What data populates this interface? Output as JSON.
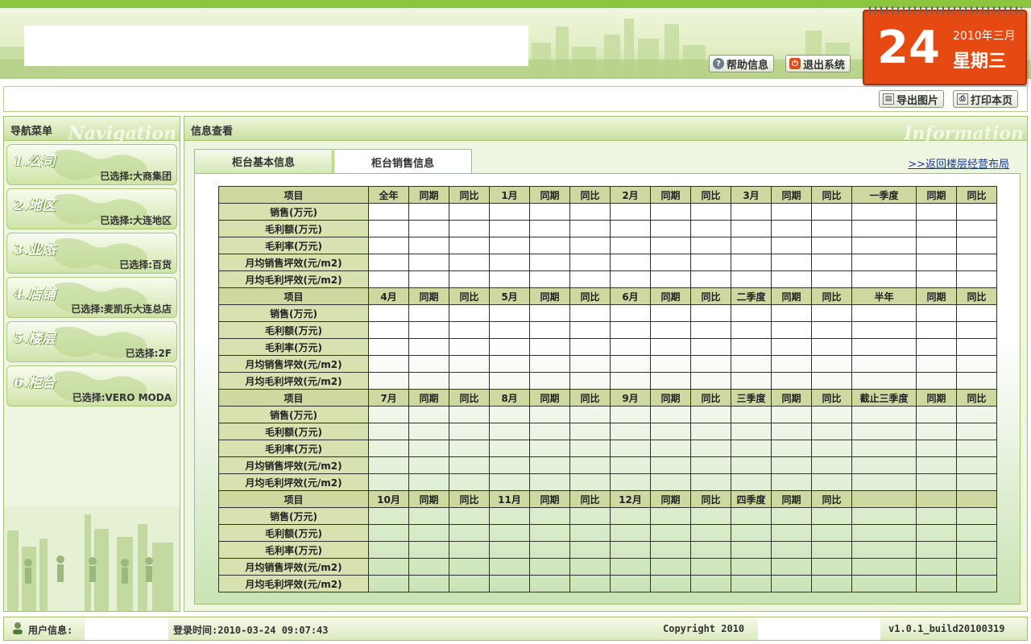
{
  "header": {
    "help_label": "帮助信息",
    "exit_label": "退出系统",
    "calendar": {
      "day": "24",
      "year_month": "2010年三月",
      "weekday": "星期三"
    }
  },
  "toolbar": {
    "export_label": "导出图片",
    "print_label": "打印本页"
  },
  "sidebar": {
    "title": "导航菜单",
    "watermark": "Navigation",
    "items": [
      {
        "num": "1.公司",
        "selected": "已选择:大商集团"
      },
      {
        "num": "2.地区",
        "selected": "已选择:大连地区"
      },
      {
        "num": "3.业态",
        "selected": "已选择:百货"
      },
      {
        "num": "4.店铺",
        "selected": "已选择:麦凯乐大连总店"
      },
      {
        "num": "5.楼层",
        "selected": "已选择:2F"
      },
      {
        "num": "6.柜台",
        "selected": "已选择:VERO MODA"
      }
    ]
  },
  "main": {
    "title": "信息查看",
    "watermark": "Information",
    "tabs": [
      {
        "label": "柜台基本信息"
      },
      {
        "label": "柜台销售信息"
      }
    ],
    "back_link": ">>返回楼层经营布局"
  },
  "table": {
    "row_labels": [
      "销售(万元)",
      "毛利额(万元)",
      "毛利率(万元)",
      "月均销售坪效(元/m2)",
      "月均毛利坪效(元/m2)"
    ],
    "blocks": [
      {
        "header": [
          "项目",
          "全年",
          "同期",
          "同比",
          "1月",
          "同期",
          "同比",
          "2月",
          "同期",
          "同比",
          "3月",
          "同期",
          "同比",
          "一季度",
          "同期",
          "同比"
        ]
      },
      {
        "header": [
          "项目",
          "4月",
          "同期",
          "同比",
          "5月",
          "同期",
          "同比",
          "6月",
          "同期",
          "同比",
          "二季度",
          "同期",
          "同比",
          "半年",
          "同期",
          "同比"
        ]
      },
      {
        "header": [
          "项目",
          "7月",
          "同期",
          "同比",
          "8月",
          "同期",
          "同比",
          "9月",
          "同期",
          "同比",
          "三季度",
          "同期",
          "同比",
          "截止三季度",
          "同期",
          "同比"
        ]
      },
      {
        "header": [
          "项目",
          "10月",
          "同期",
          "同比",
          "11月",
          "同期",
          "同比",
          "12月",
          "同期",
          "同比",
          "四季度",
          "同期",
          "同比",
          "",
          "",
          ""
        ]
      }
    ]
  },
  "footer": {
    "user_label": "用户信息:",
    "login_time": "登录时间:2010-03-24 09:07:43",
    "copyright": "Copyright 2010",
    "version": "v1.0.1_build20100319"
  }
}
